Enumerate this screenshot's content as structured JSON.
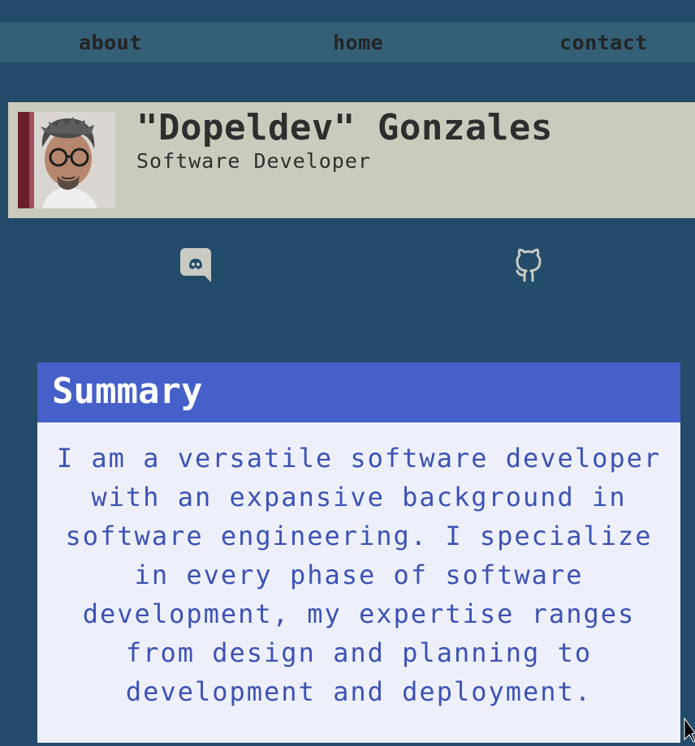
{
  "nav": {
    "about": "about",
    "home": "home",
    "contact": "contact"
  },
  "profile": {
    "name": "\"Dopeldev\" Gonzales",
    "role": "Software Developer"
  },
  "social": [
    "discord-icon",
    "github-icon"
  ],
  "summary": {
    "title": "Summary",
    "text": "I am a versatile software developer with an expansive background in software engineering. I specialize in every phase of software development, my expertise ranges from design and planning to development and deployment."
  },
  "colors": {
    "background": "#234c6a",
    "navbar": "#346077",
    "profile_card": "#cbcbbd",
    "summary_header": "#4660c9",
    "summary_body": "#edf0fa",
    "summary_text": "#3d52b5"
  }
}
